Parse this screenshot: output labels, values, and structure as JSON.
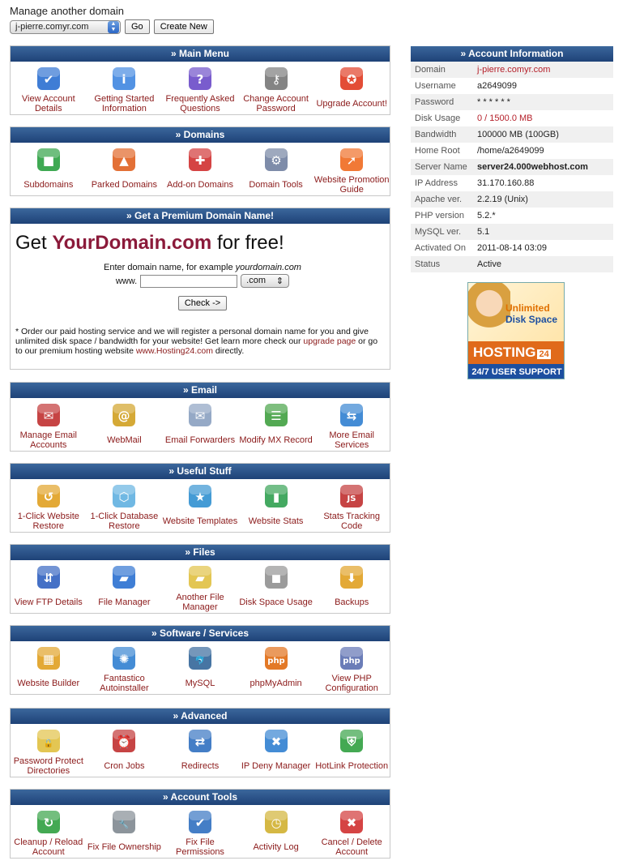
{
  "top": {
    "label": "Manage another domain",
    "domain": "j-pierre.comyr.com",
    "go": "Go",
    "create": "Create New"
  },
  "sections": [
    {
      "title": "»  Main Menu",
      "items": [
        {
          "label": "View Account Details",
          "icon": "checklist-icon"
        },
        {
          "label": "Getting Started Information",
          "icon": "info-icon"
        },
        {
          "label": "Frequently Asked Questions",
          "icon": "question-icon"
        },
        {
          "label": "Change Account Password",
          "icon": "keys-icon"
        },
        {
          "label": "Upgrade Account!",
          "icon": "ribbon-icon"
        }
      ]
    },
    {
      "title": "»  Domains",
      "items": [
        {
          "label": "Subdomains",
          "icon": "cubes-icon"
        },
        {
          "label": "Parked Domains",
          "icon": "shapes-icon"
        },
        {
          "label": "Add-on Domains",
          "icon": "network-add-icon"
        },
        {
          "label": "Domain Tools",
          "icon": "gears-icon"
        },
        {
          "label": "Website Promotion Guide",
          "icon": "arrow-circle-icon"
        }
      ]
    },
    {
      "title": "»  Email",
      "items": [
        {
          "label": "Manage Email Accounts",
          "icon": "mailbox-icon"
        },
        {
          "label": "WebMail",
          "icon": "at-book-icon"
        },
        {
          "label": "Email Forwarders",
          "icon": "envelope-forward-icon"
        },
        {
          "label": "Modify MX Record",
          "icon": "mx-record-icon"
        },
        {
          "label": "More Email Services",
          "icon": "email-network-icon"
        }
      ]
    },
    {
      "title": "»  Useful Stuff",
      "items": [
        {
          "label": "1-Click Website Restore",
          "icon": "box-restore-icon"
        },
        {
          "label": "1-Click Database Restore",
          "icon": "db-box-icon"
        },
        {
          "label": "Website Templates",
          "icon": "template-star-icon"
        },
        {
          "label": "Website Stats",
          "icon": "bar-chart-icon"
        },
        {
          "label": "Stats Tracking Code",
          "icon": "js-file-icon"
        }
      ]
    },
    {
      "title": "»  Files",
      "items": [
        {
          "label": "View FTP Details",
          "icon": "ftp-servers-icon"
        },
        {
          "label": "File Manager",
          "icon": "folder-icon"
        },
        {
          "label": "Another File Manager",
          "icon": "folder-alt-icon"
        },
        {
          "label": "Disk Space Usage",
          "icon": "disk-icon"
        },
        {
          "label": "Backups",
          "icon": "backup-icon"
        }
      ]
    },
    {
      "title": "»  Software / Services",
      "items": [
        {
          "label": "Website Builder",
          "icon": "builder-icon"
        },
        {
          "label": "Fantastico Autoinstaller",
          "icon": "fantastico-icon"
        },
        {
          "label": "MySQL",
          "icon": "mysql-dolphin-icon"
        },
        {
          "label": "phpMyAdmin",
          "icon": "phpmyadmin-icon"
        },
        {
          "label": "View PHP Configuration",
          "icon": "php-icon"
        }
      ]
    },
    {
      "title": "»  Advanced",
      "items": [
        {
          "label": "Password Protect Directories",
          "icon": "locked-folder-icon"
        },
        {
          "label": "Cron Jobs",
          "icon": "alarm-clock-icon"
        },
        {
          "label": "Redirects",
          "icon": "signpost-icon"
        },
        {
          "label": "IP Deny Manager",
          "icon": "globe-deny-icon"
        },
        {
          "label": "HotLink Protection",
          "icon": "shield-icon"
        }
      ]
    },
    {
      "title": "»  Account Tools",
      "items": [
        {
          "label": "Cleanup / Reload Account",
          "icon": "refresh-icon"
        },
        {
          "label": "Fix File Ownership",
          "icon": "wrench-icon"
        },
        {
          "label": "Fix File Permissions",
          "icon": "file-check-icon"
        },
        {
          "label": "Activity Log",
          "icon": "clock-log-icon"
        },
        {
          "label": "Cancel / Delete Account",
          "icon": "delete-icon"
        }
      ]
    }
  ],
  "premium": {
    "title": "»  Get a Premium Domain Name!",
    "headline_pre": "Get ",
    "headline_brand": "YourDomain.com",
    "headline_post": " for free!",
    "prompt": "Enter domain name, for example ",
    "prompt_example": "yourdomain.com",
    "www": "www.",
    "tld": ".com",
    "check": "Check ->",
    "note_1": "* Order our paid hosting service and we will register a personal domain name for you and give unlimited disk space / bandwidth for your website! Get learn more check our ",
    "note_link1": "upgrade page",
    "note_2": " or go to our premium hosting website ",
    "note_link2": "www.Hosting24.com",
    "note_3": " directly."
  },
  "account": {
    "title": "»  Account Information",
    "rows": [
      {
        "k": "Domain",
        "v": "j-pierre.comyr.com"
      },
      {
        "k": "Username",
        "v": "a2649099"
      },
      {
        "k": "Password",
        "v": "* * * * * *"
      },
      {
        "k": "Disk Usage",
        "v": "0 / 1500.0 MB"
      },
      {
        "k": "Bandwidth",
        "v": "100000 MB (100GB)"
      },
      {
        "k": "Home Root",
        "v": "/home/a2649099"
      },
      {
        "k": "Server Name",
        "v": "server24.000webhost.com"
      },
      {
        "k": "IP Address",
        "v": "31.170.160.88"
      },
      {
        "k": "Apache ver.",
        "v": "2.2.19 (Unix)"
      },
      {
        "k": "PHP version",
        "v": "5.2.*"
      },
      {
        "k": "MySQL ver.",
        "v": "5.1"
      },
      {
        "k": "Activated On",
        "v": "2011-08-14 03:09"
      },
      {
        "k": "Status",
        "v": "Active"
      }
    ]
  },
  "ad": {
    "line1": "Unlimited",
    "line2": "Disk Space",
    "brand": "HOSTING",
    "brand_num": "24",
    "support": "24/7 USER SUPPORT"
  }
}
